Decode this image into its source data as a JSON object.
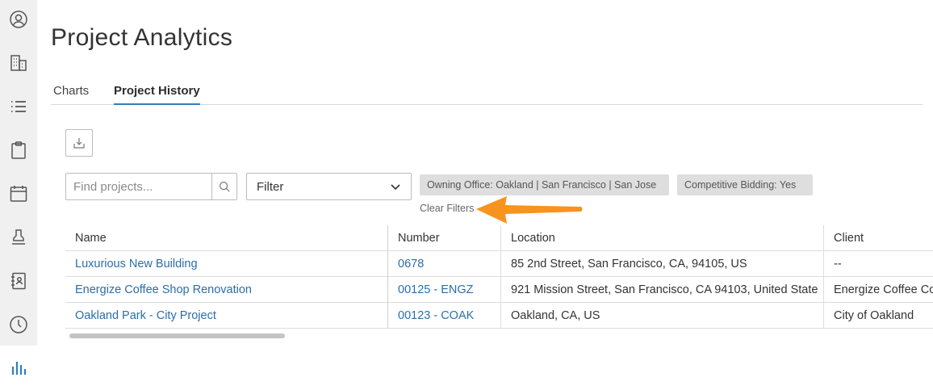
{
  "page": {
    "title": "Project Analytics"
  },
  "tabs": [
    {
      "label": "Charts",
      "active": false
    },
    {
      "label": "Project History",
      "active": true
    }
  ],
  "sidebar": {
    "icons": [
      "user-icon",
      "building-icon",
      "list-icon",
      "clipboard-icon",
      "calendar-icon",
      "stamp-icon",
      "address-book-icon",
      "clock-icon",
      "analytics-icon"
    ],
    "active": "analytics-icon"
  },
  "toolbar": {
    "search_placeholder": "Find projects...",
    "filter_label": "Filter",
    "chips": [
      "Owning Office: Oakland | San Francisco | San Jose",
      "Competitive Bidding: Yes"
    ],
    "clear_filters": "Clear Filters"
  },
  "table": {
    "columns": [
      "Name",
      "Number",
      "Location",
      "Client"
    ],
    "rows": [
      {
        "name": "Luxurious New Building",
        "number": "0678",
        "location": "85 2nd Street, San Francisco, CA, 94105, US",
        "client": "--"
      },
      {
        "name": "Energize Coffee Shop Renovation",
        "number": "00125 - ENGZ",
        "location": "921 Mission Street, San Francisco, CA 94103, United State",
        "client": "Energize Coffee Co"
      },
      {
        "name": "Oakland Park - City Project",
        "number": "00123 - COAK",
        "location": "Oakland, CA, US",
        "client": "City of Oakland"
      }
    ]
  },
  "colors": {
    "accent": "#2f7fc1",
    "link": "#2b6ea8",
    "annotation_arrow": "#f7941d",
    "sidebar_bg": "#f0f0f0",
    "chip_bg": "#dedede"
  }
}
